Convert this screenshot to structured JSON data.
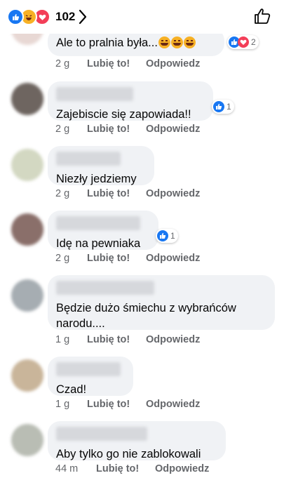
{
  "header": {
    "reaction_icons": [
      "like-icon",
      "haha-icon",
      "love-icon"
    ],
    "reaction_total": "102"
  },
  "actions": {
    "like_label": "Lubię to!",
    "reply_label": "Odpowiedz"
  },
  "comments": [
    {
      "text": "Ale to pralnia była...",
      "emoji": [
        "haha-emoji",
        "haha-emoji",
        "haha-emoji"
      ],
      "age": "2 g",
      "reactions": {
        "icons": [
          "like-icon",
          "love-icon"
        ],
        "count": "2"
      }
    },
    {
      "text": "Zajebiscie się zapowiada!!",
      "age": "2 g",
      "reactions": {
        "icons": [
          "like-icon"
        ],
        "count": "1"
      }
    },
    {
      "text": "Niezły jedziemy",
      "age": "2 g"
    },
    {
      "text": "Idę na pewniaka",
      "age": "2 g",
      "reactions": {
        "icons": [
          "like-icon"
        ],
        "count": "1"
      }
    },
    {
      "text": "Będzie dużo śmiechu z wybrańców narodu....",
      "age": "1 g"
    },
    {
      "text": "Czad!",
      "age": "1 g"
    },
    {
      "text": "Aby tylko go nie zablokowali",
      "age": "44 m"
    }
  ],
  "colors": {
    "like_blue": "#1877f2",
    "love_red": "#f33e58",
    "haha_yellow": "#f7b125",
    "bubble_gray": "#f0f2f5",
    "meta_gray": "#65676b"
  }
}
